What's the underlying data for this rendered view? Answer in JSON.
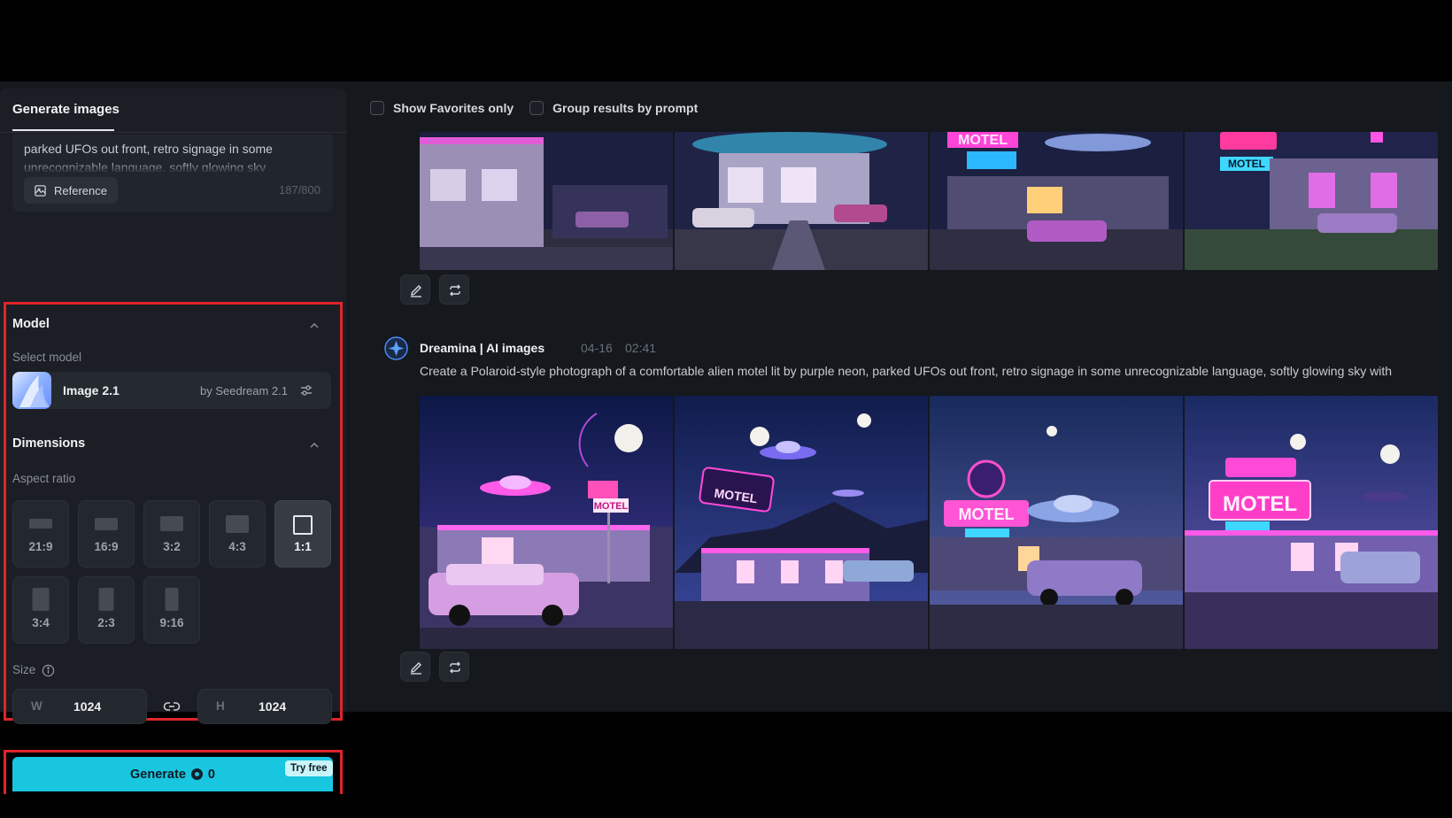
{
  "sidebar": {
    "tab_label": "Generate images",
    "prompt_text": "parked UFOs out front, retro signage in some unrecognizable language, softly glowing sky",
    "reference_label": "Reference",
    "char_count": "187/800",
    "model_section": {
      "title": "Model",
      "select_label": "Select model",
      "model_name": "Image 2.1",
      "model_by": "by Seedream 2.1"
    },
    "dimensions": {
      "title": "Dimensions",
      "aspect_label": "Aspect ratio",
      "ratios": [
        "21:9",
        "16:9",
        "3:2",
        "4:3",
        "1:1",
        "3:4",
        "2:3",
        "9:16"
      ],
      "selected_ratio": "1:1",
      "size_label": "Size",
      "width_key": "W",
      "width_value": "1024",
      "height_key": "H",
      "height_value": "1024"
    },
    "generate": {
      "label": "Generate",
      "cost": "0",
      "badge": "Try free"
    }
  },
  "main": {
    "filters": {
      "favorites_label": "Show Favorites only",
      "group_label": "Group results by prompt"
    },
    "result": {
      "source": "Dreamina | AI images",
      "date": "04-16",
      "time": "02:41",
      "prompt": "Create a Polaroid-style photograph of a comfortable alien motel lit by purple neon, parked UFOs out front, retro signage in some unrecognizable language, softly glowing sky with"
    },
    "motel_sign_texts": [
      "MOTEL",
      "MOTEL",
      "MOTEL",
      "MOTEL",
      "MOTEL",
      "MOTEL",
      "MOTEL"
    ]
  },
  "colors": {
    "accent": "#19c6e0",
    "highlight_border": "#e0242a",
    "neon_pink": "#e04ddb",
    "neon_cyan": "#3fd7ff"
  }
}
